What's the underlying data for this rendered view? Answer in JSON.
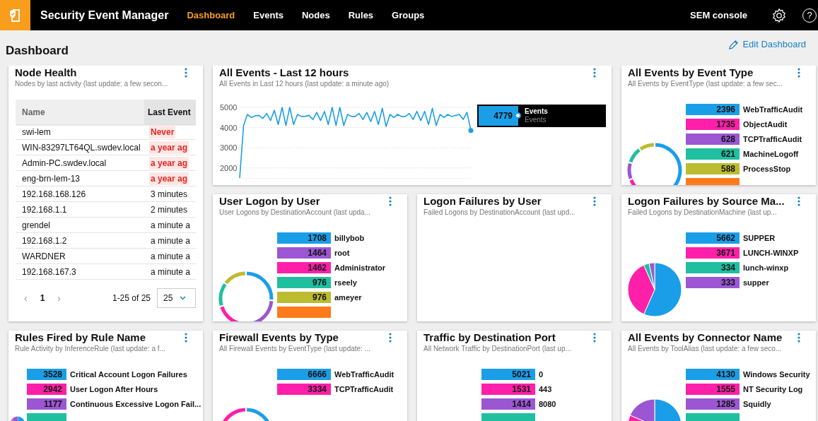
{
  "app": {
    "title": "Security Event Manager"
  },
  "nav": [
    {
      "label": "Dashboard",
      "selected": true
    },
    {
      "label": "Events",
      "selected": false
    },
    {
      "label": "Nodes",
      "selected": false
    },
    {
      "label": "Rules",
      "selected": false
    },
    {
      "label": "Groups",
      "selected": false
    }
  ],
  "console_link": "SEM console",
  "help_glyph": "?",
  "page": {
    "title": "Dashboard",
    "edit_link": "Edit Dashboard"
  },
  "node_health": {
    "title": "Node Health",
    "subtitle": "Nodes by last activity (last update: a few secon...",
    "columns": [
      "Name",
      "Last Event"
    ],
    "rows": [
      {
        "name": "swi-lem",
        "last_event": "Never",
        "stale": true
      },
      {
        "name": "WIN-83297LT64QL.swdev.local",
        "last_event": "a year ag",
        "stale": true
      },
      {
        "name": "Admin-PC.swdev.local",
        "last_event": "a year ag",
        "stale": true
      },
      {
        "name": "eng-brn-lem-13",
        "last_event": "a year ag",
        "stale": true
      },
      {
        "name": "192.168.168.126",
        "last_event": "3 minutes",
        "stale": false
      },
      {
        "name": "192.168.1.1",
        "last_event": "2 minutes",
        "stale": false
      },
      {
        "name": "grendel",
        "last_event": "a minute a",
        "stale": false
      },
      {
        "name": "192.168.1.2",
        "last_event": "a minute a",
        "stale": false
      },
      {
        "name": "WARDNER",
        "last_event": "a minute a",
        "stale": false
      },
      {
        "name": "192.168.167.3",
        "last_event": "a minute a",
        "stale": false
      }
    ],
    "pager": {
      "prev": "‹",
      "page": "1",
      "next": "›",
      "range": "1-25 of 25",
      "page_size": "25"
    }
  },
  "all_events": {
    "title": "All Events - Last 12 hours",
    "subtitle": "All Events in Last 12 hours (last update: a minute ago)",
    "chart_data": {
      "type": "line",
      "yticks": [
        2000,
        3000,
        4000,
        5000
      ],
      "ylim": [
        1500,
        5000
      ],
      "grid": true,
      "series": [
        {
          "name": "Events",
          "color": "#1b9ee8",
          "values": [
            1500,
            4100,
            4650,
            4500,
            4580,
            4600,
            4450,
            4700,
            4350,
            4850,
            4150,
            5000,
            4100,
            5000,
            4150,
            4650,
            4550,
            4560,
            4600,
            4400,
            4750,
            4350,
            4800,
            4150,
            5000,
            4100,
            5000,
            4100,
            4650,
            4550,
            4550,
            4700,
            4400,
            4750,
            4300,
            4800,
            4150,
            4950,
            4050,
            4650,
            4500,
            4650,
            4550,
            4550,
            4700,
            4400,
            4800,
            4350,
            4800,
            4150,
            4950,
            4100,
            4650,
            4500,
            4650,
            4550,
            4600,
            4650,
            4400,
            4750,
            3850
          ]
        }
      ]
    },
    "legend": {
      "value": "4779",
      "sublabel": "Events"
    }
  },
  "widgets": [
    {
      "title": "All Events by Event Type",
      "subtitle": "All Events by EventType (last update: a few sec...",
      "kind": "donut",
      "legend": [
        {
          "value": "2396",
          "label": "WebTrafficAudit",
          "color": "#1b9ee8"
        },
        {
          "value": "1735",
          "label": "ObjectAudit",
          "color": "#ff1fa8"
        },
        {
          "value": "628",
          "label": "TCPTrafficAudit",
          "color": "#9b57d3"
        },
        {
          "value": "621",
          "label": "MachineLogoff",
          "color": "#1fbf9f"
        },
        {
          "value": "588",
          "label": "ProcessStop",
          "color": "#bdbb2f"
        },
        {
          "color": "#ff7a1a"
        }
      ]
    },
    {
      "title": "User Logon by User",
      "subtitle": "User Logons by DestinationAccount (last upda...",
      "kind": "donut",
      "legend": [
        {
          "value": "1708",
          "label": "billybob",
          "color": "#1b9ee8"
        },
        {
          "value": "1464",
          "label": "root",
          "color": "#9b57d3"
        },
        {
          "value": "1462",
          "label": "Administrator",
          "color": "#ff1fa8"
        },
        {
          "value": "976",
          "label": "rseely",
          "color": "#1fbf9f"
        },
        {
          "value": "976",
          "label": "ameyer",
          "color": "#bdbb2f"
        },
        {
          "color": "#ff7a1a"
        }
      ]
    },
    {
      "title": "Logon Failures by User",
      "subtitle": "Failed Logons by DestinationAccount (last upd...",
      "kind": "empty"
    },
    {
      "title": "Logon Failures by Source Ma...",
      "subtitle": "Failed Logons by DestinationMachine (last up...",
      "kind": "pie",
      "legend": [
        {
          "value": "5662",
          "label": "SUPPER",
          "color": "#1b9ee8"
        },
        {
          "value": "3671",
          "label": "LUNCH-WINXP",
          "color": "#ff1fa8"
        },
        {
          "value": "334",
          "label": "lunch-winxp",
          "color": "#1fbf9f"
        },
        {
          "value": "333",
          "label": "supper",
          "color": "#9b57d3"
        }
      ]
    },
    {
      "title": "Rules Fired by Rule Name",
      "subtitle": "Rule Activity by InferenceRule (last update: a f...",
      "kind": "small_pie",
      "legend": [
        {
          "value": "3528",
          "label": "Critical Account Logon Failures",
          "color": "#1b9ee8"
        },
        {
          "value": "2942",
          "label": "User Logon After Hours",
          "color": "#ff1fa8"
        },
        {
          "value": "1177",
          "label": "Continuous Excessive Logon Fail...",
          "color": "#9b57d3"
        },
        {
          "color": "#1fbf9f"
        }
      ]
    },
    {
      "title": "Firewall Events by Type",
      "subtitle": "All Firewall Events by EventType (last update: ...",
      "kind": "donut",
      "legend": [
        {
          "value": "6666",
          "label": "WebTrafficAudit",
          "color": "#1b9ee8"
        },
        {
          "value": "3334",
          "label": "TCPTrafficAudit",
          "color": "#ff1fa8"
        }
      ]
    },
    {
      "title": "Traffic by Destination Port",
      "subtitle": "All Network Traffic by DestinationPort (last up...",
      "kind": "legend",
      "legend": [
        {
          "value": "5021",
          "label": "0",
          "color": "#1b9ee8"
        },
        {
          "value": "1531",
          "label": "443",
          "color": "#ff1fa8"
        },
        {
          "value": "1414",
          "label": "8080",
          "color": "#9b57d3"
        },
        {
          "color": "#1fbf9f"
        }
      ]
    },
    {
      "title": "All Events by Connector Name",
      "subtitle": "All Events by ToolAlias (last update: a few seco...",
      "kind": "pie",
      "legend": [
        {
          "value": "4130",
          "label": "Windows Security",
          "color": "#1b9ee8"
        },
        {
          "value": "1555",
          "label": "NT Security Log",
          "color": "#ff1fa8"
        },
        {
          "value": "1285",
          "label": "Squidly",
          "color": "#9b57d3"
        },
        {
          "color": "#1fbf9f"
        }
      ]
    }
  ]
}
